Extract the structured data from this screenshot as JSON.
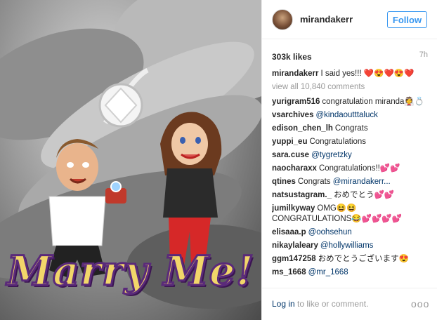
{
  "post": {
    "image_caption_overlay": "Marry Me!"
  },
  "header": {
    "username": "mirandakerr",
    "follow_label": "Follow",
    "accent_color": "#3897f0"
  },
  "stats": {
    "likes": "303k likes",
    "time_ago": "7h"
  },
  "caption": {
    "user": "mirandakerr",
    "text": "I said yes!!! ❤️😍❤️😍❤️"
  },
  "view_all_comments": "view all 10,840 comments",
  "comments": [
    {
      "user": "yurigram516",
      "text": "congratulation miranda👰💍",
      "mention": ""
    },
    {
      "user": "vsarchives",
      "text": "",
      "mention": "@kindaoutttaluck"
    },
    {
      "user": "edison_chen_lh",
      "text": "Congrats",
      "mention": ""
    },
    {
      "user": "yuppi_eu",
      "text": "Congratulations",
      "mention": ""
    },
    {
      "user": "sara.cuse",
      "text": "",
      "mention": "@tygretzky"
    },
    {
      "user": "naocharaxx",
      "text": "Congratulations!!💕💕",
      "mention": ""
    },
    {
      "user": "qtines",
      "text": "Congrats",
      "mention": "@mirandakerr..."
    },
    {
      "user": "natsustagram._",
      "text": "おめでとう💕💕",
      "mention": ""
    },
    {
      "user": "jumilkyway",
      "text": "OMG😆😆 CONGRATULATIONS😂💕💕💕💕",
      "mention": ""
    },
    {
      "user": "elisaaa.p",
      "text": "",
      "mention": "@oohsehun"
    },
    {
      "user": "nikaylaleary",
      "text": "",
      "mention": "@hollywilliams"
    },
    {
      "user": "ggm147258",
      "text": "おめでとうございます😍",
      "mention": ""
    },
    {
      "user": "ms_1668",
      "text": "",
      "mention": "@mr_1668"
    }
  ],
  "footer": {
    "login_label": "Log in",
    "login_suffix": " to like or comment.",
    "more_label": "ooo"
  }
}
